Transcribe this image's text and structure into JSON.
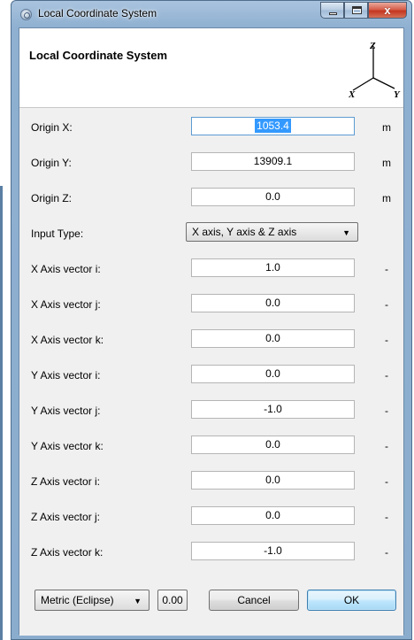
{
  "window": {
    "title": "Local Coordinate System",
    "close_glyph": "x"
  },
  "header": {
    "title": "Local Coordinate System",
    "axes_icon": {
      "x": "X",
      "y": "Y",
      "z": "Z"
    }
  },
  "fields": [
    {
      "label": "Origin X:",
      "value": "1053.4",
      "unit": "m",
      "active": true
    },
    {
      "label": "Origin Y:",
      "value": "13909.1",
      "unit": "m"
    },
    {
      "label": "Origin Z:",
      "value": "0.0",
      "unit": "m"
    },
    {
      "label": "Input Type:",
      "select": "X axis, Y axis & Z axis"
    },
    {
      "label": "X Axis vector i:",
      "value": "1.0",
      "unit": "-"
    },
    {
      "label": "X Axis vector j:",
      "value": "0.0",
      "unit": "-"
    },
    {
      "label": "X Axis vector k:",
      "value": "0.0",
      "unit": "-"
    },
    {
      "label": "Y Axis vector i:",
      "value": "0.0",
      "unit": "-"
    },
    {
      "label": "Y Axis vector j:",
      "value": "-1.0",
      "unit": "-"
    },
    {
      "label": "Y Axis vector k:",
      "value": "0.0",
      "unit": "-"
    },
    {
      "label": "Z Axis vector i:",
      "value": "0.0",
      "unit": "-"
    },
    {
      "label": "Z Axis vector j:",
      "value": "0.0",
      "unit": "-"
    },
    {
      "label": "Z Axis vector k:",
      "value": "-1.0",
      "unit": "-"
    }
  ],
  "footer": {
    "unit_system": "Metric (Eclipse)",
    "precision": "0.00",
    "cancel_label": "Cancel",
    "ok_label": "OK"
  },
  "colors": {
    "title_bar": "#a9c3de",
    "selection": "#3399ff",
    "ok_border": "#3c7fb1"
  }
}
